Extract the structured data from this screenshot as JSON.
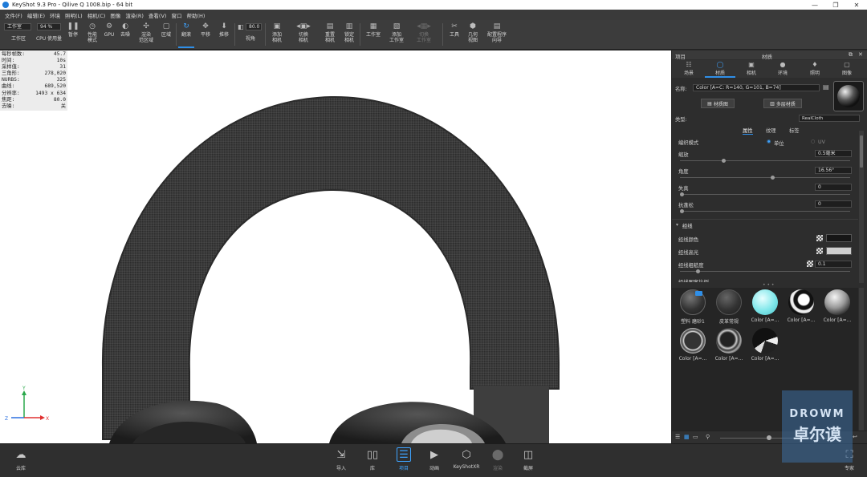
{
  "window": {
    "title": "KeyShot 9.3 Pro  -  Qilive Q 1008.bip  -  64 bit",
    "controls": [
      "—",
      "❐",
      "✕"
    ]
  },
  "menu": [
    "文件(F)",
    "编辑(E)",
    "环境",
    "照明(L)",
    "相机(C)",
    "图像",
    "渲染(R)",
    "查看(V)",
    "窗口",
    "帮助(H)"
  ],
  "toolbar": {
    "workspace_value": "工作室",
    "workspace_label": "工作区",
    "cpu_value": "94 %",
    "cpu_label": "CPU 使用量",
    "pause": "暂停",
    "perf_mode": "性能\n模式",
    "gpu": "GPU",
    "denoise": "去噪",
    "render_area": "渲染\n范区域",
    "region": "区域",
    "tumble": "翻滚",
    "pan": "平移",
    "dolly": "推移",
    "fov_value": "80.0",
    "fov_label": "视角",
    "add_camera": "添加\n相机",
    "switch_camera": "切换\n相机",
    "reset_camera": "重置\n相机",
    "lock_camera": "锁定\n相机",
    "studio": "工作室",
    "add_studio": "添加\n工作室",
    "switch_studio": "切换\n工作室",
    "tools": "工具",
    "geometry_view": "几何\n视图",
    "config_view": "配置程序\n向导"
  },
  "stats": [
    {
      "label": "每秒帧数:",
      "value": "45.7"
    },
    {
      "label": "时间:",
      "value": "10s"
    },
    {
      "label": "采样值:",
      "value": "31"
    },
    {
      "label": "三角形:",
      "value": "278,020"
    },
    {
      "label": "NURBS:",
      "value": "325"
    },
    {
      "label": "曲线:",
      "value": "689,520"
    },
    {
      "label": "分辨率:",
      "value": "1493 x 634"
    },
    {
      "label": "焦距:",
      "value": "80.0"
    },
    {
      "label": "去噪:",
      "value": "关"
    }
  ],
  "axis": {
    "x": "X",
    "y": "Y",
    "z": "Z"
  },
  "panel": {
    "header_left": "项目",
    "header_center": "材质",
    "tabs": [
      {
        "icon": "scene-icon",
        "label": "场景"
      },
      {
        "icon": "material-icon",
        "label": "材质"
      },
      {
        "icon": "camera-icon",
        "label": "相机"
      },
      {
        "icon": "environment-icon",
        "label": "环境"
      },
      {
        "icon": "lighting-icon",
        "label": "照明"
      },
      {
        "icon": "image-icon",
        "label": "图像"
      }
    ],
    "name_label": "名称:",
    "name_value": "Color [A=C: R=140, G=101, B=74]",
    "material_graph": "材质图",
    "multi_layer": "多层材质",
    "type_label": "类型:",
    "type_value": "RealCloth",
    "subtabs": [
      "属性",
      "纹理",
      "标签"
    ],
    "props": {
      "weave_mode": "编织模式",
      "unit_option": "单位",
      "uv_option": "UV",
      "scale": "缩放",
      "scale_value": "0.5毫米",
      "angle": "角度",
      "angle_value": "16.56°",
      "distortion": "失真",
      "distortion_value": "0",
      "fuzz": "抗蓬松",
      "fuzz_value": "0"
    },
    "warp_section": "经线",
    "warp": {
      "color": "经线颜色",
      "highlight": "经线高光",
      "roughness": "经线粗糙度",
      "roughness_value": "0.1",
      "truncated": "经线图案比例"
    },
    "library": [
      {
        "label": "塑料 磨砂1"
      },
      {
        "label": "皮革常规"
      },
      {
        "label": "Color [A=..."
      },
      {
        "label": "Color [A=..."
      },
      {
        "label": "Color [A=..."
      },
      {
        "label": "Color [A=..."
      },
      {
        "label": "Color [A=..."
      },
      {
        "label": "Color [A=..."
      }
    ]
  },
  "bottom": {
    "cloud": "云库",
    "import": "导入",
    "library": "库",
    "project": "项目",
    "animation": "动画",
    "keyshotxr": "KeyShotXR",
    "render": "渲染",
    "screenshot": "截屏",
    "expert": "专家"
  },
  "watermark": {
    "line1": "DROWM",
    "line2": "卓尔谟"
  },
  "colors": {
    "accent": "#2f8fe8",
    "headphone": "#3a3a3a",
    "panel_bg": "#2d2d2d"
  }
}
